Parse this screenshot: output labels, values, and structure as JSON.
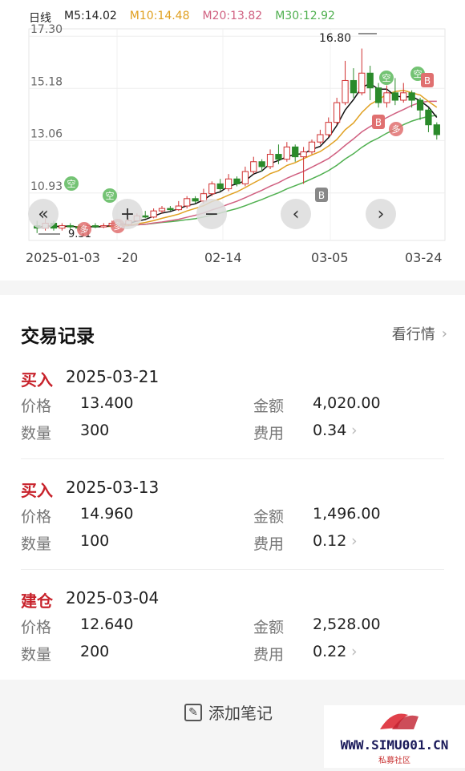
{
  "chart": {
    "legend": {
      "period": "日线",
      "ma5": "M5:14.02",
      "ma10": "M10:14.48",
      "ma20": "M20:13.82",
      "ma30": "M30:12.92"
    },
    "colors": {
      "ma5": "#111111",
      "ma10": "#e0a020",
      "ma20": "#d06080",
      "ma30": "#50b050",
      "up": "#d03030",
      "down": "#2a8a2a"
    },
    "y_ticks": [
      "17.30",
      "15.18",
      "13.06",
      "10.93"
    ],
    "high_label": "16.80",
    "low_label": "9.31",
    "x_labels": [
      "2025-01-03",
      "-20",
      "02-14",
      "03-05",
      "03-24"
    ],
    "nav": {
      "prev_prev": "«",
      "zoom_in": "+",
      "zoom_out": "−",
      "prev": "‹",
      "next": "›"
    },
    "marker_b": "B",
    "marker_kong": "空",
    "marker_duo": "多"
  },
  "chart_data": {
    "type": "candlestick",
    "ylim": [
      9.0,
      17.6
    ],
    "candles": [
      [
        9.6,
        9.5,
        9.8,
        9.3
      ],
      [
        9.5,
        9.7,
        9.9,
        9.4
      ],
      [
        9.7,
        9.5,
        9.8,
        9.4
      ],
      [
        9.5,
        9.6,
        9.7,
        9.4
      ],
      [
        9.6,
        9.55,
        9.7,
        9.45
      ],
      [
        9.55,
        9.5,
        9.65,
        9.4
      ],
      [
        9.5,
        9.6,
        9.7,
        9.45
      ],
      [
        9.6,
        9.55,
        9.7,
        9.5
      ],
      [
        9.55,
        9.6,
        9.7,
        9.5
      ],
      [
        9.6,
        9.7,
        9.8,
        9.55
      ],
      [
        9.7,
        9.65,
        9.8,
        9.6
      ],
      [
        9.65,
        9.8,
        9.9,
        9.6
      ],
      [
        9.8,
        10.0,
        10.1,
        9.75
      ],
      [
        10.0,
        9.95,
        10.2,
        9.9
      ],
      [
        9.95,
        10.2,
        10.3,
        9.9
      ],
      [
        10.2,
        10.3,
        10.4,
        10.1
      ],
      [
        10.3,
        10.25,
        10.4,
        10.2
      ],
      [
        10.25,
        10.4,
        10.6,
        10.2
      ],
      [
        10.4,
        10.7,
        10.8,
        10.3
      ],
      [
        10.7,
        10.6,
        10.8,
        10.5
      ],
      [
        10.6,
        10.9,
        11.1,
        10.5
      ],
      [
        10.9,
        11.3,
        11.4,
        10.8
      ],
      [
        11.3,
        11.1,
        11.5,
        11.0
      ],
      [
        11.1,
        11.5,
        11.7,
        11.0
      ],
      [
        11.5,
        11.3,
        11.6,
        11.2
      ],
      [
        11.3,
        11.8,
        12.0,
        11.2
      ],
      [
        11.8,
        12.2,
        12.4,
        11.7
      ],
      [
        12.2,
        12.0,
        12.3,
        11.8
      ],
      [
        12.0,
        12.5,
        12.7,
        11.9
      ],
      [
        12.5,
        12.3,
        12.9,
        12.1
      ],
      [
        12.3,
        12.8,
        13.0,
        12.2
      ],
      [
        12.8,
        12.4,
        12.9,
        12.2
      ],
      [
        12.4,
        12.6,
        12.8,
        11.3
      ],
      [
        12.6,
        13.0,
        13.1,
        12.5
      ],
      [
        13.0,
        13.3,
        13.5,
        12.9
      ],
      [
        13.3,
        13.8,
        14.0,
        13.2
      ],
      [
        13.8,
        14.6,
        14.8,
        13.7
      ],
      [
        14.6,
        15.5,
        16.3,
        14.5
      ],
      [
        15.5,
        15.0,
        16.0,
        14.8
      ],
      [
        15.0,
        15.8,
        16.8,
        14.9
      ],
      [
        15.8,
        15.2,
        16.1,
        14.7
      ],
      [
        15.2,
        14.6,
        15.4,
        14.4
      ],
      [
        14.6,
        15.0,
        15.3,
        14.4
      ],
      [
        15.0,
        14.7,
        15.6,
        14.5
      ],
      [
        14.7,
        15.0,
        15.4,
        14.6
      ],
      [
        15.0,
        14.7,
        15.1,
        14.4
      ],
      [
        14.7,
        14.3,
        14.8,
        13.9
      ],
      [
        14.3,
        13.7,
        14.4,
        13.4
      ],
      [
        13.7,
        13.3,
        13.8,
        13.1
      ]
    ]
  },
  "panel": {
    "title": "交易记录",
    "view_market": "看行情",
    "records": [
      {
        "type": "买入",
        "date": "2025-03-21",
        "price_label": "价格",
        "price": "13.400",
        "amount_label": "金额",
        "amount": "4,020.00",
        "qty_label": "数量",
        "qty": "300",
        "fee_label": "费用",
        "fee": "0.34"
      },
      {
        "type": "买入",
        "date": "2025-03-13",
        "price_label": "价格",
        "price": "14.960",
        "amount_label": "金额",
        "amount": "1,496.00",
        "qty_label": "数量",
        "qty": "100",
        "fee_label": "费用",
        "fee": "0.12"
      },
      {
        "type": "建仓",
        "date": "2025-03-04",
        "price_label": "价格",
        "price": "12.640",
        "amount_label": "金额",
        "amount": "2,528.00",
        "qty_label": "数量",
        "qty": "200",
        "fee_label": "费用",
        "fee": "0.22"
      }
    ]
  },
  "footer": {
    "add_note": "添加笔记"
  },
  "watermark": {
    "text": "WWW.SIMU001.CN",
    "sub": "私募社区"
  }
}
